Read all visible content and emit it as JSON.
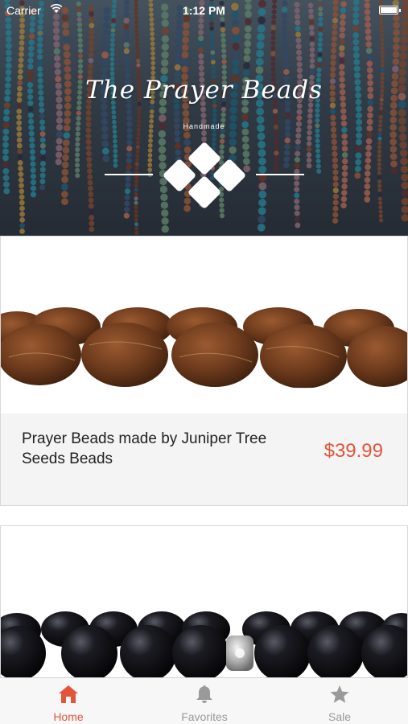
{
  "status_bar": {
    "carrier": "Carrier",
    "time": "1:12 PM"
  },
  "hero": {
    "title": "The Prayer Beads",
    "subtitle": "Handmade"
  },
  "products": [
    {
      "name": "Prayer Beads made by Juniper Tree Seeds Beads",
      "price": "$39.99"
    },
    {
      "name": "",
      "price": ""
    }
  ],
  "tabs": [
    {
      "label": "Home",
      "icon": "home-icon",
      "active": true
    },
    {
      "label": "Favorites",
      "icon": "bell-icon",
      "active": false
    },
    {
      "label": "Sale",
      "icon": "star-icon",
      "active": false
    }
  ],
  "colors": {
    "accent": "#e2553b",
    "inactive": "#9a9a9a",
    "text": "#222222",
    "info_bg": "#f4f4f4"
  }
}
